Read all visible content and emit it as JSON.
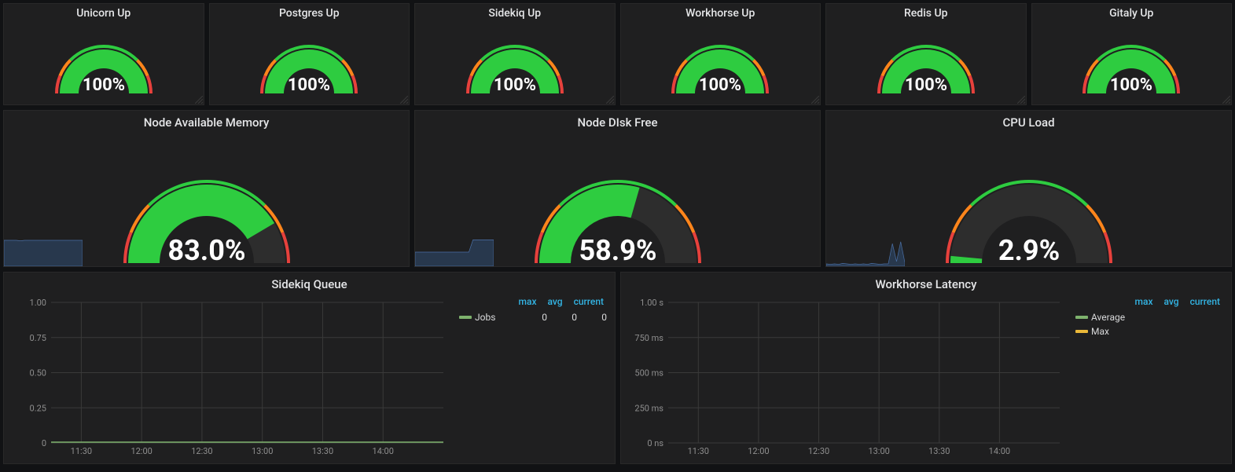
{
  "colors": {
    "green": "#2ecc40",
    "orange": "#ff851b",
    "red": "#e7413c",
    "sparkline": "#2e4a6d",
    "grid": "#3a3a3a",
    "axis_text": "#8e8e8e",
    "legend_header": "#33b5e5",
    "swatch_green": "#7eb26d",
    "swatch_orange": "#eab839"
  },
  "row1": [
    {
      "title": "Unicorn Up",
      "value": 100,
      "display": "100%"
    },
    {
      "title": "Postgres Up",
      "value": 100,
      "display": "100%"
    },
    {
      "title": "Sidekiq Up",
      "value": 100,
      "display": "100%"
    },
    {
      "title": "Workhorse Up",
      "value": 100,
      "display": "100%"
    },
    {
      "title": "Redis Up",
      "value": 100,
      "display": "100%"
    },
    {
      "title": "Gitaly Up",
      "value": 100,
      "display": "100%"
    }
  ],
  "row2": [
    {
      "title": "Node Available Memory",
      "value": 83.0,
      "display": "83.0%",
      "spark": [
        0.55,
        0.55,
        0.55,
        0.55,
        0.54,
        0.55,
        0.55,
        0.55,
        0.55,
        0.55,
        0.55,
        0.55,
        0.55,
        0.55,
        0.55,
        0.55,
        0.55,
        0.55,
        0.55,
        0.55
      ]
    },
    {
      "title": "Node DIsk Free",
      "value": 58.9,
      "display": "58.9%",
      "spark": [
        0.3,
        0.3,
        0.3,
        0.3,
        0.3,
        0.3,
        0.3,
        0.3,
        0.3,
        0.3,
        0.3,
        0.3,
        0.3,
        0.3,
        0.56,
        0.56,
        0.56,
        0.56,
        0.56,
        0.56
      ]
    },
    {
      "title": "CPU Load",
      "value": 2.9,
      "display": "2.9%",
      "spark": [
        0.05,
        0.04,
        0.05,
        0.04,
        0.06,
        0.05,
        0.04,
        0.05,
        0.04,
        0.05,
        0.04,
        0.06,
        0.05,
        0.04,
        0.05,
        0.05,
        0.48,
        0.1,
        0.52,
        0.08
      ]
    }
  ],
  "row3": {
    "legend_headers": [
      "max",
      "avg",
      "current"
    ],
    "left": {
      "title": "Sidekiq Queue",
      "yticks": [
        "1.00",
        "0.75",
        "0.50",
        "0.25",
        "0"
      ],
      "xticks": [
        "11:30",
        "12:00",
        "12:30",
        "13:00",
        "13:30",
        "14:00"
      ],
      "series": [
        {
          "name": "Jobs",
          "color": "#7eb26d",
          "max": "0",
          "avg": "0",
          "current": "0"
        }
      ]
    },
    "right": {
      "title": "Workhorse Latency",
      "yticks": [
        "1.00 s",
        "750 ms",
        "500 ms",
        "250 ms",
        "0 ns"
      ],
      "xticks": [
        "11:30",
        "12:00",
        "12:30",
        "13:00",
        "13:30",
        "14:00"
      ],
      "series": [
        {
          "name": "Average",
          "color": "#7eb26d"
        },
        {
          "name": "Max",
          "color": "#eab839"
        }
      ]
    }
  },
  "chart_data": [
    {
      "type": "gauge",
      "title": "Unicorn Up",
      "value": 100,
      "unit": "%",
      "range": [
        0,
        100
      ]
    },
    {
      "type": "gauge",
      "title": "Postgres Up",
      "value": 100,
      "unit": "%",
      "range": [
        0,
        100
      ]
    },
    {
      "type": "gauge",
      "title": "Sidekiq Up",
      "value": 100,
      "unit": "%",
      "range": [
        0,
        100
      ]
    },
    {
      "type": "gauge",
      "title": "Workhorse Up",
      "value": 100,
      "unit": "%",
      "range": [
        0,
        100
      ]
    },
    {
      "type": "gauge",
      "title": "Redis Up",
      "value": 100,
      "unit": "%",
      "range": [
        0,
        100
      ]
    },
    {
      "type": "gauge",
      "title": "Gitaly Up",
      "value": 100,
      "unit": "%",
      "range": [
        0,
        100
      ]
    },
    {
      "type": "gauge",
      "title": "Node Available Memory",
      "value": 83.0,
      "unit": "%",
      "range": [
        0,
        100
      ]
    },
    {
      "type": "gauge",
      "title": "Node DIsk Free",
      "value": 58.9,
      "unit": "%",
      "range": [
        0,
        100
      ]
    },
    {
      "type": "gauge",
      "title": "CPU Load",
      "value": 2.9,
      "unit": "%",
      "range": [
        0,
        100
      ]
    },
    {
      "type": "line",
      "title": "Sidekiq Queue",
      "xlabel": "",
      "ylabel": "",
      "x": [
        "11:30",
        "12:00",
        "12:30",
        "13:00",
        "13:30",
        "14:00"
      ],
      "ylim": [
        0,
        1
      ],
      "series": [
        {
          "name": "Jobs",
          "values": [
            0,
            0,
            0,
            0,
            0,
            0
          ],
          "max": 0,
          "avg": 0,
          "current": 0
        }
      ]
    },
    {
      "type": "line",
      "title": "Workhorse Latency",
      "xlabel": "",
      "ylabel": "",
      "x": [
        "11:30",
        "12:00",
        "12:30",
        "13:00",
        "13:30",
        "14:00"
      ],
      "ylim_label": [
        "0 ns",
        "1.00 s"
      ],
      "series": [
        {
          "name": "Average"
        },
        {
          "name": "Max"
        }
      ]
    }
  ]
}
